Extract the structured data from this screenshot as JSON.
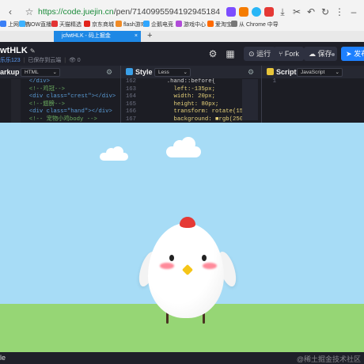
{
  "browser": {
    "url_host": "https://code.juejin.cn",
    "url_path": "/pen/7140995594192945184",
    "bookmarks": [
      {
        "label": "上网导航",
        "color": "#3a7ff6"
      },
      {
        "label": "NOW直播",
        "color": "#3db2ff"
      },
      {
        "label": "天猫精选",
        "color": "#e33333"
      },
      {
        "label": "京东商城",
        "color": "#e2231a"
      },
      {
        "label": "flash游戏",
        "color": "#f08a24"
      },
      {
        "label": "企鹅电竞",
        "color": "#2fa6ff"
      },
      {
        "label": "游戏中心",
        "color": "#b04bd8"
      },
      {
        "label": "爱淘宝",
        "color": "#ff6a00"
      },
      {
        "label": "从 Chrome 中导",
        "color": "#777777"
      }
    ],
    "tab_title": "jcfwtHLK - 码上掘金",
    "new_tab_symbol": "+"
  },
  "header": {
    "title": "wtHLK",
    "edit_icon": "pencil-icon",
    "author": "乐乐123",
    "saved_status": "已保存到云端",
    "views": "0",
    "run_label": "运行",
    "fork_label": "Fork",
    "save_label": "保存",
    "publish_label": "发布"
  },
  "editors": {
    "html": {
      "title": "arkup",
      "language": "HTML",
      "lines": [
        {
          "text": "  </div>",
          "color": "#5a9bd5"
        },
        {
          "text": "  <!--鸡冠-->",
          "color": "#6aab5e"
        },
        {
          "text": "  <div class=\"crest\"></div>",
          "color": "#5a9bd5"
        },
        {
          "text": "  <!--翅膀-->",
          "color": "#6aab5e"
        },
        {
          "text": "  <div class=\"hand\"></div>",
          "color": "#5a9bd5"
        },
        {
          "text": "  <!-- 宠物小鸡body -->",
          "color": "#6aab5e"
        }
      ]
    },
    "css": {
      "title": "Style",
      "language": "Less",
      "line_numbers": [
        "162",
        "163",
        "164",
        "165",
        "166",
        "167"
      ],
      "lines": [
        {
          "text": "  .hand::before{",
          "color": "#cfcfcf"
        },
        {
          "text": "    left:-135px;",
          "color": "#e7d27a"
        },
        {
          "text": "    width: 20px;",
          "color": "#e7d27a"
        },
        {
          "text": "    height: 80px;",
          "color": "#e7d27a"
        },
        {
          "text": "    transform: rotate(15de",
          "color": "#e7d27a"
        },
        {
          "text": "    background: ■rgb(250",
          "color": "#e7d27a"
        }
      ]
    },
    "js": {
      "title": "Script",
      "language": "JavaScript",
      "line_numbers": [
        "1"
      ]
    }
  },
  "preview": {
    "sky_color": "#a7dcf6",
    "ground_color": "#96d675",
    "chick_body_color": "#ffffff",
    "crest_color": "#e53935",
    "beak_color": "#f5c518",
    "blush_color": "#ff8a9a"
  },
  "footer": {
    "left_label": "le",
    "watermark": "@稀土掘金技术社区"
  }
}
